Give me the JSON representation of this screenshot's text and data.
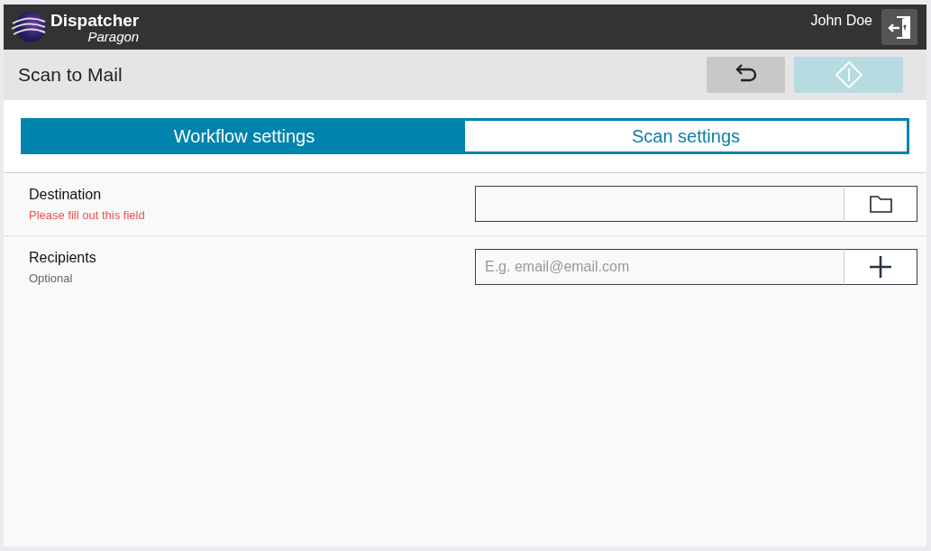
{
  "header": {
    "brand": "Dispatcher",
    "subbrand": "Paragon",
    "user": "John Doe"
  },
  "toolbar": {
    "title": "Scan to Mail",
    "start_disabled": true
  },
  "tabs": [
    {
      "label": "Workflow settings",
      "selected": true
    },
    {
      "label": "Scan settings",
      "selected": false
    }
  ],
  "fields": [
    {
      "label": "Destination",
      "hint": {
        "text": "Please fill out this field",
        "kind": "error"
      },
      "action": {
        "kind": "folder"
      }
    },
    {
      "label": "Recipients",
      "hint": {
        "text": "Optional",
        "kind": "optional"
      },
      "placeholder": "E.g. email@email.com",
      "action": {
        "kind": "add"
      }
    }
  ]
}
